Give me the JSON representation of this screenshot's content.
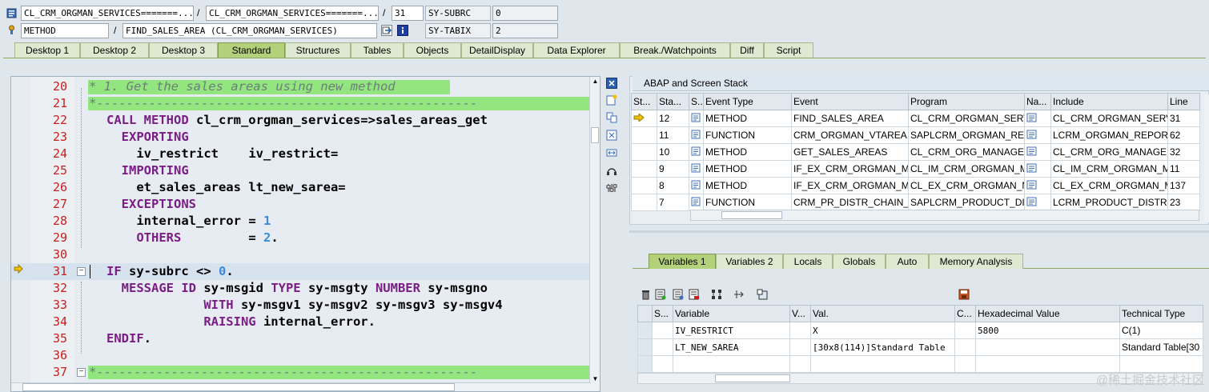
{
  "top_fields": {
    "row1": {
      "class1": "CL_CRM_ORGMAN_SERVICES=======...",
      "class2": "CL_CRM_ORGMAN_SERVICES=======...",
      "line": "31",
      "var_name": "SY-SUBRC",
      "var_value": "0"
    },
    "row2": {
      "type": "METHOD",
      "name": "FIND_SALES_AREA (CL_CRM_ORGMAN_SERVICES)",
      "var_name": "SY-TABIX",
      "var_value": "2"
    },
    "slash": "/"
  },
  "tabs": [
    "Desktop 1",
    "Desktop 2",
    "Desktop 3",
    "Standard",
    "Structures",
    "Tables",
    "Objects",
    "DetailDisplay",
    "Data Explorer",
    "Break./Watchpoints",
    "Diff",
    "Script"
  ],
  "editor": {
    "lines": [
      {
        "n": "20",
        "text": "* 1. Get the sales areas using new method"
      },
      {
        "n": "21",
        "text": "*---------------------------------------------------"
      },
      {
        "n": "22",
        "kw": "CALL METHOD",
        "rest": " cl_crm_orgman_services=>sales_areas_get"
      },
      {
        "n": "23",
        "kw": "  EXPORTING",
        "rest": ""
      },
      {
        "n": "24",
        "pre": "    iv_restrict    ",
        "op": "= ",
        "rest": "iv_restrict"
      },
      {
        "n": "25",
        "kw": "  IMPORTING",
        "rest": ""
      },
      {
        "n": "26",
        "pre": "    et_sales_areas ",
        "op": "= ",
        "rest": "lt_new_sarea"
      },
      {
        "n": "27",
        "kw": "  EXCEPTIONS",
        "rest": ""
      },
      {
        "n": "28",
        "pre": "    internal_error ",
        "op": "= ",
        "num": "1"
      },
      {
        "n": "29",
        "kwpre": "    OTHERS",
        "op": "         = ",
        "num": "2",
        "tail": "."
      },
      {
        "n": "30",
        "text": ""
      },
      {
        "n": "31",
        "kw": "IF",
        "rest": " sy-subrc ",
        "op": "<> ",
        "num": "0",
        "tail": "."
      },
      {
        "n": "32",
        "kw": "  MESSAGE ID",
        "rest": " sy-msgid ",
        "kw2": "TYPE",
        "rest2": " sy-msgty ",
        "kw3": "NUMBER",
        "rest3": " sy-msgno"
      },
      {
        "n": "33",
        "kw": "             WITH",
        "rest": " sy-msgv1 sy-msgv2 sy-msgv3 sy-msgv4"
      },
      {
        "n": "34",
        "kw": "             RAISING",
        "rest": " internal_error."
      },
      {
        "n": "35",
        "kw": "ENDIF",
        "rest": "."
      },
      {
        "n": "36",
        "text": ""
      },
      {
        "n": "37",
        "text": "*---------------------------------------------------"
      }
    ]
  },
  "stack": {
    "title": "ABAP and Screen Stack",
    "headers": [
      "St...",
      "Sta...",
      "S...",
      "Event Type",
      "Event",
      "Program",
      "Na...",
      "Include",
      "Line"
    ],
    "rows": [
      [
        "12",
        "METHOD",
        "FIND_SALES_AREA",
        "CL_CRM_ORGMAN_SERVICES",
        "CL_CRM_ORGMAN_SERV...",
        "31"
      ],
      [
        "11",
        "FUNCTION",
        "CRM_ORGMAN_VTAREA...",
        "SAPLCRM_ORGMAN_REP...",
        "LCRM_ORGMAN_REPORT...",
        "62"
      ],
      [
        "10",
        "METHOD",
        "GET_SALES_AREAS",
        "CL_CRM_ORG_MANAGEM...",
        "CL_CRM_ORG_MANAGEM...",
        "32"
      ],
      [
        "9",
        "METHOD",
        "IF_EX_CRM_ORGMAN_M...",
        "CL_IM_CRM_ORGMAN_M...",
        "CL_IM_CRM_ORGMAN_M...",
        "11"
      ],
      [
        "8",
        "METHOD",
        "IF_EX_CRM_ORGMAN_M...",
        "CL_EX_CRM_ORGMAN_M...",
        "CL_EX_CRM_ORGMAN_M...",
        "137"
      ],
      [
        "7",
        "FUNCTION",
        "CRM_PR_DISTR_CHAIN_...",
        "SAPLCRM_PRODUCT_DIS...",
        "LCRM_PRODUCT_DISTR...",
        "23"
      ]
    ]
  },
  "var_tabs": [
    "Variables 1",
    "Variables 2",
    "Locals",
    "Globals",
    "Auto",
    "Memory Analysis"
  ],
  "vars": {
    "headers": [
      "S...",
      "Variable",
      "V...",
      "Val.",
      "C...",
      "Hexadecimal Value",
      "Technical Type"
    ],
    "rows": [
      [
        "IV_RESTRICT",
        "X",
        "5800",
        "C(1)"
      ],
      [
        "LT_NEW_SAREA",
        "[30x8(114)]Standard Table",
        "",
        "Standard Table[30"
      ]
    ]
  },
  "watermark": "@稀土掘金技术社区"
}
